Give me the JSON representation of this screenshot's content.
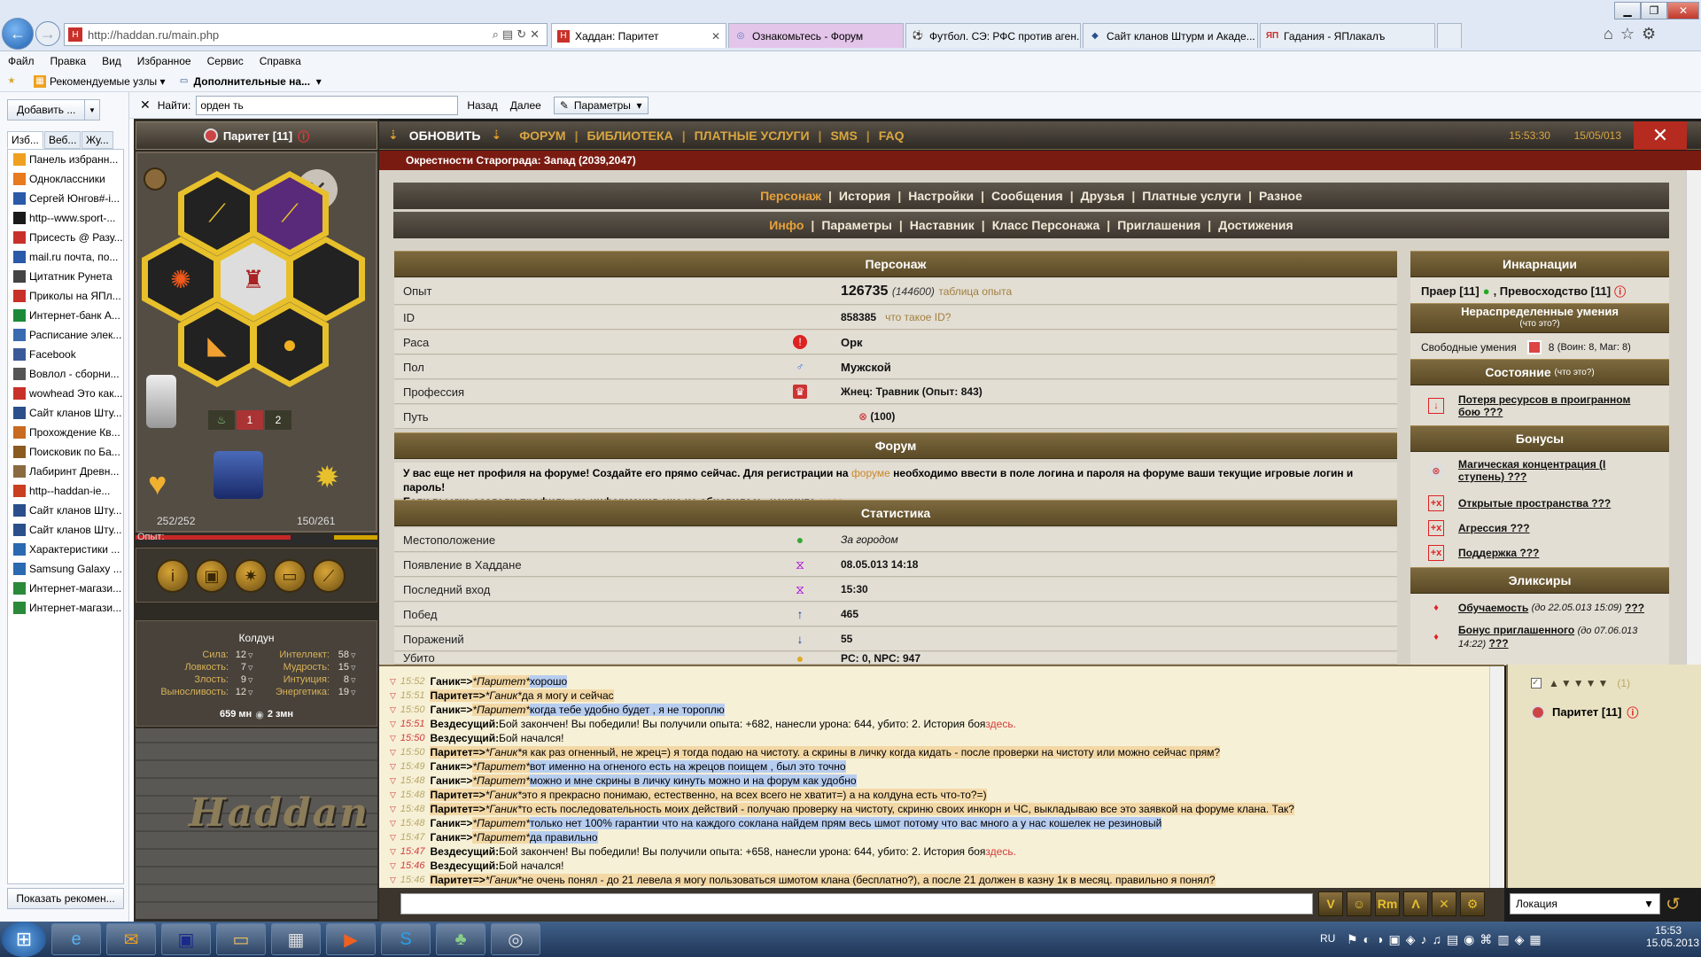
{
  "browser": {
    "url": "http://haddan.ru/main.php",
    "tabs": [
      {
        "label": "Хаддан: Паритет",
        "active": true
      },
      {
        "label": "Ознакомьтесь - Форум"
      },
      {
        "label": "Футбол. СЭ: РФС против аген..."
      },
      {
        "label": "Сайт кланов Штурм и Акаде..."
      },
      {
        "label": "Гадания - ЯПлакалъ"
      }
    ],
    "menu": [
      "Файл",
      "Правка",
      "Вид",
      "Избранное",
      "Сервис",
      "Справка"
    ],
    "favbar": {
      "recommended": "Рекомендуемые узлы",
      "extra": "Дополнительные на..."
    },
    "sidebar": {
      "add_label": "Добавить ...",
      "tabs": [
        "Изб...",
        "Веб...",
        "Жу..."
      ],
      "items": [
        "Панель избранн...",
        "Одноклассники",
        "Сергей Юнгов#-i...",
        "http--www.sport-...",
        "Присесть @ Разу...",
        "mail.ru почта, по...",
        "Цитатник Рунета",
        "Приколы на ЯПл...",
        "Интернет-банк А...",
        "Расписание элек...",
        "Facebook",
        "Вовлол - сборни...",
        "wowhead Это как...",
        "Сайт кланов Шту...",
        "Прохождение Кв...",
        "Поисковик по Ба...",
        "Лабиринт Древн...",
        "http--haddan-ie...",
        "Сайт кланов Шту...",
        "Сайт кланов Шту...",
        "Характеристики ...",
        "Samsung Galaxy ...",
        "Интернет-магази...",
        "Интернет-магази..."
      ],
      "show_recommended": "Показать рекомен..."
    },
    "find": {
      "label": "Найти:",
      "value": "орден ть",
      "prev": "Назад",
      "next": "Далее",
      "params": "Параметры"
    }
  },
  "game": {
    "character_title": "Паритет [11]",
    "hp": "252/252",
    "mana": "150/261",
    "exp_label": "Опыт:",
    "slot_labels": [
      "1",
      "2"
    ],
    "class_name": "Колдун",
    "stats_left": [
      {
        "label": "Сила:",
        "value": "12"
      },
      {
        "label": "Ловкость:",
        "value": "7"
      },
      {
        "label": "Злость:",
        "value": "9"
      },
      {
        "label": "Выносливость:",
        "value": "12"
      }
    ],
    "stats_right": [
      {
        "label": "Интеллект:",
        "value": "58"
      },
      {
        "label": "Мудрость:",
        "value": "15"
      },
      {
        "label": "Интуиция:",
        "value": "8"
      },
      {
        "label": "Энергетика:",
        "value": "19"
      }
    ],
    "money": "659 мн",
    "money2": "2 змн",
    "logo": "Haddan",
    "topbar": {
      "refresh": "ОБНОВИТЬ",
      "links": [
        "ФОРУМ",
        "БИБЛИОТЕКА",
        "ПЛАТНЫЕ УСЛУГИ",
        "SMS",
        "FAQ"
      ],
      "time": "15:53:30",
      "date": "15/05/013"
    },
    "location": "Окрестности Старограда: Запад (2039,2047)",
    "nav1": {
      "active": "Персонаж",
      "items": [
        "История",
        "Настройки",
        "Сообщения",
        "Друзья",
        "Платные услуги",
        "Разное"
      ]
    },
    "nav2": {
      "active": "Инфо",
      "items": [
        "Параметры",
        "Наставник",
        "Класс Персонажа",
        "Приглашения",
        "Достижения"
      ]
    },
    "sections": {
      "character": "Персонаж",
      "forum": "Форум",
      "stats": "Статистика"
    },
    "character_rows": {
      "exp_label": "Опыт",
      "exp_value": "126735",
      "exp_next": "(144600)",
      "exp_table": "таблица опыта",
      "id_label": "ID",
      "id_value": "858385",
      "id_hint": "что такое ID?",
      "race_label": "Раса",
      "race_value": "Орк",
      "sex_label": "Пол",
      "sex_value": "Мужской",
      "prof_label": "Профессия",
      "prof_value": "Жнец: Травник (Опыт: 843)",
      "path_label": "Путь",
      "path_value": "(100)"
    },
    "forum_text": {
      "part1": "У вас еще нет профиля на форуме! Создайте его прямо сейчас. Для регистрации на",
      "link1": "форуме",
      "part2": "необходимо ввести в поле логина и пароля на форуме ваши текущие игровые логин и пароль!",
      "part3": "Если вы уже создали профиль, но информация еще не обновилась, нажмите",
      "link2": "сюда"
    },
    "stats_rows": [
      {
        "label": "Местоположение",
        "value": "За городом",
        "italic": true
      },
      {
        "label": "Появление в Хаддане",
        "value": "08.05.013 14:18"
      },
      {
        "label": "Последний вход",
        "value": "15:30"
      },
      {
        "label": "Побед",
        "value": "465"
      },
      {
        "label": "Поражений",
        "value": "55"
      },
      {
        "label": "Убито",
        "value": "PC: 0, NPC: 947"
      }
    ],
    "right": {
      "incarnations_title": "Инкарнации",
      "incarnations": "Праер [11]",
      "incarnations2": "Превосходство [11]",
      "skills_title": "Нераспределенные умения",
      "skills_hint": "(что это?)",
      "free_skills_label": "Свободные умения",
      "free_skills_value": "8",
      "free_skills_detail": "(Воин: 8, Маг: 8)",
      "state_title": "Состояние",
      "state_hint": "(что это?)",
      "state_item": "Потеря ресурсов в проигранном бою ???",
      "bonus_title": "Бонусы",
      "bonuses": [
        "Магическая концентрация (I ступень) ???",
        "Открытые пространства ???",
        "Агрессия ???",
        "Поддержка ???"
      ],
      "elixir_title": "Эликсиры",
      "elixir1": "Обучаемость",
      "elixir1_until": "(до 22.05.013 15:09)",
      "elixir2": "Бонус приглашенного",
      "elixir2_until": "(до 07.06.013 14:22)",
      "qqq": "???"
    },
    "chat": [
      {
        "time": "15:52",
        "from": "Ганик",
        "to": "*Паритет*",
        "text": "хорошо",
        "hl": "b"
      },
      {
        "time": "15:51",
        "from": "Паритет",
        "to": "*Ганик*",
        "text": "да я могу и сейчас",
        "hl": "o"
      },
      {
        "time": "15:50",
        "from": "Ганик",
        "to": "*Паритет*",
        "text": "когда тебе удобно будет , я не тороплю",
        "hl": "b"
      },
      {
        "time": "15:51",
        "from": "Вездесущий:",
        "text": "Бой закончен! Вы победили! Вы получили опыта: +682, нанесли урона: 644, убито: 2. История боя",
        "link": "здесь.",
        "red": true
      },
      {
        "time": "15:50",
        "from": "Вездесущий:",
        "text": "Бой начался!",
        "red": true
      },
      {
        "time": "15:50",
        "from": "Паритет",
        "to": "*Ганик*",
        "text": "я как раз огненный, не жрец=) я тогда подаю на чистоту. а скрины в личку когда кидать - после проверки на чистоту или можно сейчас прям?",
        "hl": "o"
      },
      {
        "time": "15:49",
        "from": "Ганик",
        "to": "*Паритет*",
        "text": "вот именно на огненого есть на жрецов поищем , был это точно",
        "hl": "b"
      },
      {
        "time": "15:48",
        "from": "Ганик",
        "to": "*Паритет*",
        "text": "можно и мне скрины в личку кинуть можно и на форум как удобно",
        "hl": "b"
      },
      {
        "time": "15:48",
        "from": "Паритет",
        "to": "*Ганик*",
        "text": "это я прекрасно понимаю, естественно, на всех всего не хватит=) а на колдуна есть что-то?=)",
        "hl": "o"
      },
      {
        "time": "15:48",
        "from": "Паритет",
        "to": "*Ганик*",
        "text": "то есть последовательность моих действий - получаю проверку на чистоту, скриню своих инкорн и ЧС, выкладываю все это заявкой на форуме клана. Так?",
        "hl": "o"
      },
      {
        "time": "15:48",
        "from": "Ганик",
        "to": "*Паритет*",
        "text": "только нет 100% гарантии что на каждого соклана найдем прям весь шмот потому что вас много а у нас кошелек не резиновый",
        "hl": "b"
      },
      {
        "time": "15:47",
        "from": "Ганик",
        "to": "*Паритет*",
        "text": "да правильно",
        "hl": "b"
      },
      {
        "time": "15:47",
        "from": "Вездесущий:",
        "text": "Бой закончен! Вы победили! Вы получили опыта: +658, нанесли урона: 644, убито: 2. История боя",
        "link": "здесь.",
        "red": true
      },
      {
        "time": "15:46",
        "from": "Вездесущий:",
        "text": "Бой начался!",
        "red": true
      },
      {
        "time": "15:46",
        "from": "Паритет",
        "to": "*Ганик*",
        "text": "не очень понял - до 21 левела я могу пользоваться шмотом клана (бесплатно?), а после 21 должен в казну 1к в месяц. правильно я понял?",
        "hl": "o"
      }
    ],
    "online": {
      "count": "(1)",
      "player": "Паритет [11]"
    },
    "location_select": "Локация"
  },
  "taskbar": {
    "lang": "RU",
    "time": "15:53",
    "date": "15.05.2013"
  },
  "colors": {
    "accent": "#d9a640",
    "location_bar": "#7a1b12",
    "chat_bg": "#f6f0d6"
  }
}
